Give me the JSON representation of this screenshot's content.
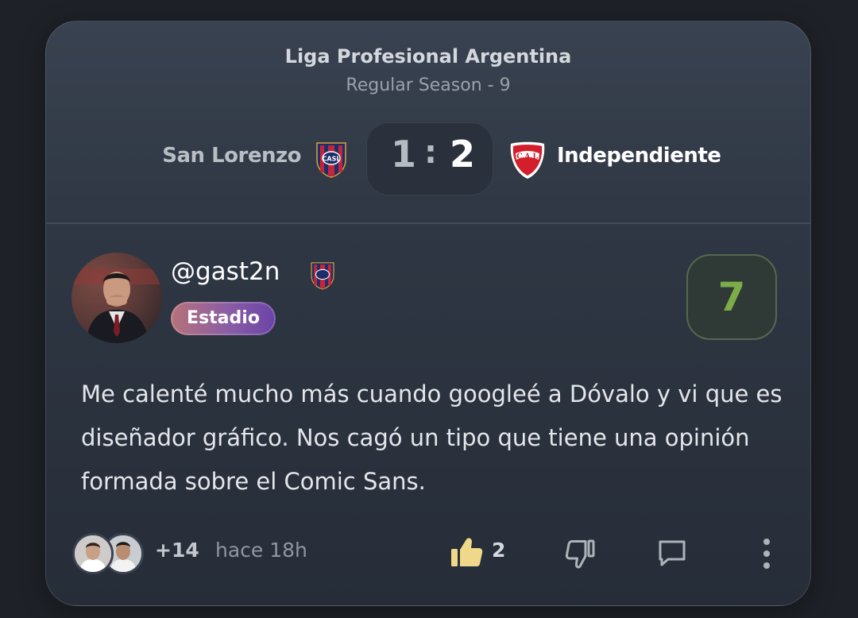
{
  "match": {
    "league": "Liga Profesional Argentina",
    "round": "Regular Season - 9",
    "home_team": "San Lorenzo",
    "away_team": "Independiente",
    "home_score": "1",
    "separator": ":",
    "away_score": "2",
    "home_crest_icon": "san-lorenzo-crest-icon",
    "away_crest_icon": "independiente-crest-icon"
  },
  "review": {
    "username": "@gast2n",
    "badge": "Estadio",
    "rating": "7",
    "rating_color": "#7dac48",
    "comment": "Me calenté mucho más cuando googleé a Dóvalo y vi que es diseñador gráfico. Nos cagó un tipo que tiene una opinión formada sobre el Comic Sans."
  },
  "footer": {
    "more_reactors": "+14",
    "time": "hace 18h",
    "likes": "2",
    "like_color": "#f0d88a"
  }
}
